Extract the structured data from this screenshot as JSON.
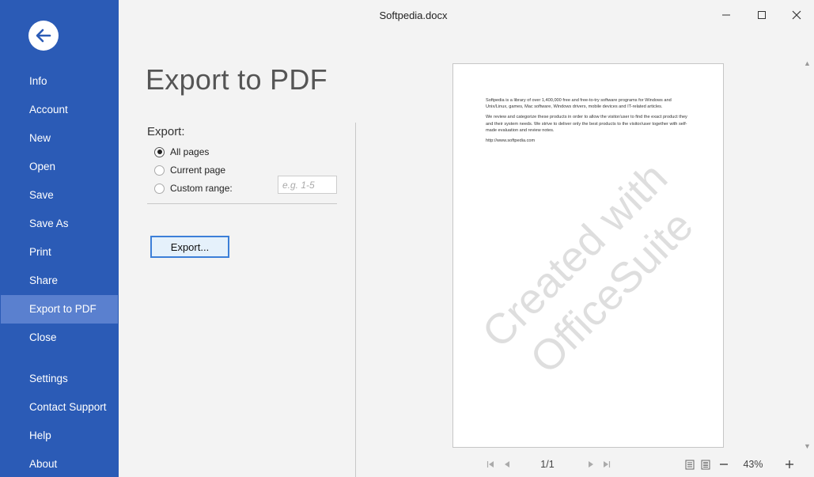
{
  "window": {
    "title": "Softpedia.docx"
  },
  "sidebar": {
    "items": [
      {
        "label": "Info",
        "active": false
      },
      {
        "label": "Account",
        "active": false
      },
      {
        "label": "New",
        "active": false
      },
      {
        "label": "Open",
        "active": false
      },
      {
        "label": "Save",
        "active": false
      },
      {
        "label": "Save As",
        "active": false
      },
      {
        "label": "Print",
        "active": false
      },
      {
        "label": "Share",
        "active": false
      },
      {
        "label": "Export to PDF",
        "active": true
      },
      {
        "label": "Close",
        "active": false
      },
      {
        "label": "Settings",
        "active": false
      },
      {
        "label": "Contact Support",
        "active": false
      },
      {
        "label": "Help",
        "active": false
      },
      {
        "label": "About",
        "active": false
      }
    ]
  },
  "main": {
    "title": "Export to PDF",
    "export_label": "Export:",
    "options": [
      {
        "label": "All pages",
        "checked": true
      },
      {
        "label": "Current page",
        "checked": false
      },
      {
        "label": "Custom range:",
        "checked": false
      }
    ],
    "range_placeholder": "e.g. 1-5",
    "export_button": "Export..."
  },
  "preview": {
    "paragraphs": [
      "Softpedia is a library of over 1,400,000 free and free-to-try software programs for Windows and Unix/Linux, games, Mac software, Windows drivers, mobile devices and IT-related articles.",
      "We review and categorize these products in order to allow the visitor/user to find the exact product they and their system needs. We strive to deliver only the best products to the visitor/user together with self-made evaluation and review notes.",
      "http://www.softpedia.com"
    ],
    "watermark_line1": "Created with",
    "watermark_line2": "OfficeSuite"
  },
  "footer": {
    "page_indicator": "1/1",
    "zoom": "43%"
  },
  "colors": {
    "sidebar_bg": "#2b5bb6",
    "sidebar_active": "#5a80cf",
    "accent": "#3c7fd8"
  }
}
